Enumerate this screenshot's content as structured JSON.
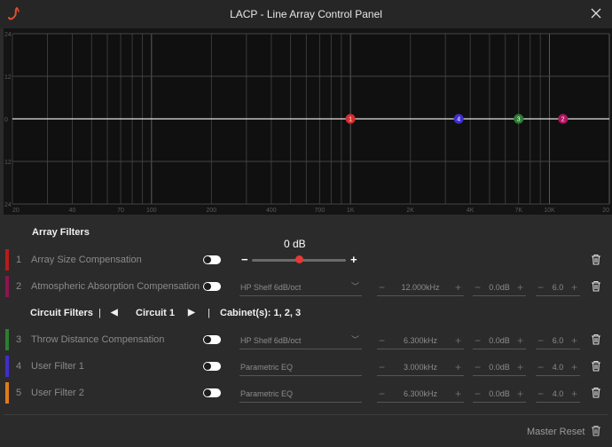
{
  "window": {
    "title": "LACP - Line Array Control Panel"
  },
  "plot": {
    "y_labels": [
      "24",
      "12",
      "0",
      "12",
      "24"
    ],
    "x_labels": [
      "20",
      "40",
      "70",
      "100",
      "200",
      "400",
      "700",
      "1K",
      "2K",
      "4K",
      "7K",
      "10K",
      "20"
    ],
    "markers": [
      {
        "id": "1",
        "freq_hz": 1000,
        "gain_db": 0,
        "color": "#d32f2f"
      },
      {
        "id": "4",
        "freq_hz": 3500,
        "gain_db": 0,
        "color": "#3f2ecf"
      },
      {
        "id": "3",
        "freq_hz": 7000,
        "gain_db": 0,
        "color": "#2e7d32"
      },
      {
        "id": "2",
        "freq_hz": 11700,
        "gain_db": 0,
        "color": "#b0145f"
      }
    ]
  },
  "array_filters": {
    "title": "Array Filters",
    "gain_value": "0 dB",
    "gain_position": 0.5,
    "rows": [
      {
        "num": "1",
        "name": "Array Size Compensation",
        "color": "#b71c1c",
        "type": "",
        "freq": "",
        "gain": "",
        "q": ""
      },
      {
        "num": "2",
        "name": "Atmospheric Absorption Compensation",
        "color": "#8e1450",
        "type": "HP Shelf 6dB/oct",
        "freq": "12.000kHz",
        "gain": "0.0dB",
        "q": "6.0"
      }
    ]
  },
  "circuit_filters": {
    "title": "Circuit Filters",
    "sep1": "|",
    "circuit": "Circuit 1",
    "sep2": "|",
    "cabinets": "Cabinet(s): 1, 2, 3",
    "prev_icon": "◀",
    "next_icon": "▶",
    "rows": [
      {
        "num": "3",
        "name": "Throw Distance Compensation",
        "color": "#2e7d32",
        "type": "HP Shelf 6dB/oct",
        "freq": "6.300kHz",
        "gain": "0.0dB",
        "q": "6.0"
      },
      {
        "num": "4",
        "name": "User Filter 1",
        "color": "#3f2ecf",
        "type": "Parametric EQ",
        "freq": "3.000kHz",
        "gain": "0.0dB",
        "q": "4.0"
      },
      {
        "num": "5",
        "name": "User Filter 2",
        "color": "#e07a1f",
        "type": "Parametric EQ",
        "freq": "6.300kHz",
        "gain": "0.0dB",
        "q": "4.0"
      }
    ]
  },
  "footer": {
    "master_reset": "Master Reset"
  },
  "glyphs": {
    "minus": "−",
    "plus": "+",
    "chevron": "﹀"
  }
}
